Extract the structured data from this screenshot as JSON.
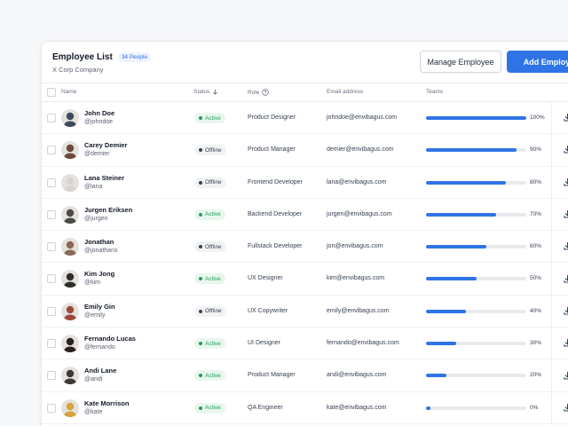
{
  "header": {
    "title": "Employee List",
    "count_badge": "34 People",
    "company": "X Corp Company"
  },
  "actions": {
    "manage_label": "Manage Employee",
    "add_label": "Add Employee"
  },
  "columns": {
    "name": "Name",
    "status": "Status",
    "role": "Role",
    "email": "Email address",
    "teams": "Teams"
  },
  "colors": {
    "accent": "#2f74e6",
    "active_text": "#1f9d55",
    "active_bg": "#e8f7ee",
    "offline_text": "#374151",
    "offline_bg": "#f1f2f4"
  },
  "employees": [
    {
      "name": "John Doe",
      "handle": "@johndoe",
      "status": "Active",
      "role": "Product Designer",
      "email": "johndoe@envibagus.com",
      "teams_pct": "100%",
      "teams_value": 100
    },
    {
      "name": "Carey Demier",
      "handle": "@demier",
      "status": "Offline",
      "role": "Product Manager",
      "email": "demier@envibagus.com",
      "teams_pct": "90%",
      "teams_value": 90
    },
    {
      "name": "Lana Steiner",
      "handle": "@lana",
      "status": "Offline",
      "role": "Frontend Developer",
      "email": "lana@envibagus.com",
      "teams_pct": "80%",
      "teams_value": 80
    },
    {
      "name": "Jurgen Eriksen",
      "handle": "@jurgen",
      "status": "Active",
      "role": "Backend Developer",
      "email": "jurgen@envibagus.com",
      "teams_pct": "70%",
      "teams_value": 70
    },
    {
      "name": "Jonathan",
      "handle": "@jonathanx",
      "status": "Offline",
      "role": "Fullstack Developer",
      "email": "jon@envibagus.com",
      "teams_pct": "60%",
      "teams_value": 60
    },
    {
      "name": "Kim Jong",
      "handle": "@kim",
      "status": "Active",
      "role": "UX Designer",
      "email": "kim@envibagus.com",
      "teams_pct": "50%",
      "teams_value": 50
    },
    {
      "name": "Emily Gin",
      "handle": "@emily",
      "status": "Offline",
      "role": "UX Copywriter",
      "email": "emily@envibagus.com",
      "teams_pct": "40%",
      "teams_value": 40
    },
    {
      "name": "Fernando Lucas",
      "handle": "@fernando",
      "status": "Active",
      "role": "UI Designer",
      "email": "fernando@envibagus.com",
      "teams_pct": "30%",
      "teams_value": 30
    },
    {
      "name": "Andi Lane",
      "handle": "@andi",
      "status": "Active",
      "role": "Product Manager",
      "email": "andi@envibagus.com",
      "teams_pct": "20%",
      "teams_value": 20
    },
    {
      "name": "Kate Morrison",
      "handle": "@kate",
      "status": "Active",
      "role": "QA Engineer",
      "email": "kate@envibagus.com",
      "teams_pct": "0%",
      "teams_value": 4
    }
  ],
  "avatars": [
    "#3b4a5c",
    "#6b4a3a",
    "#d9d4cf",
    "#4a4a4a",
    "#8a6a55",
    "#2e2e2e",
    "#9a4a3a",
    "#2a2020",
    "#3a3a3a",
    "#d8a23a"
  ]
}
